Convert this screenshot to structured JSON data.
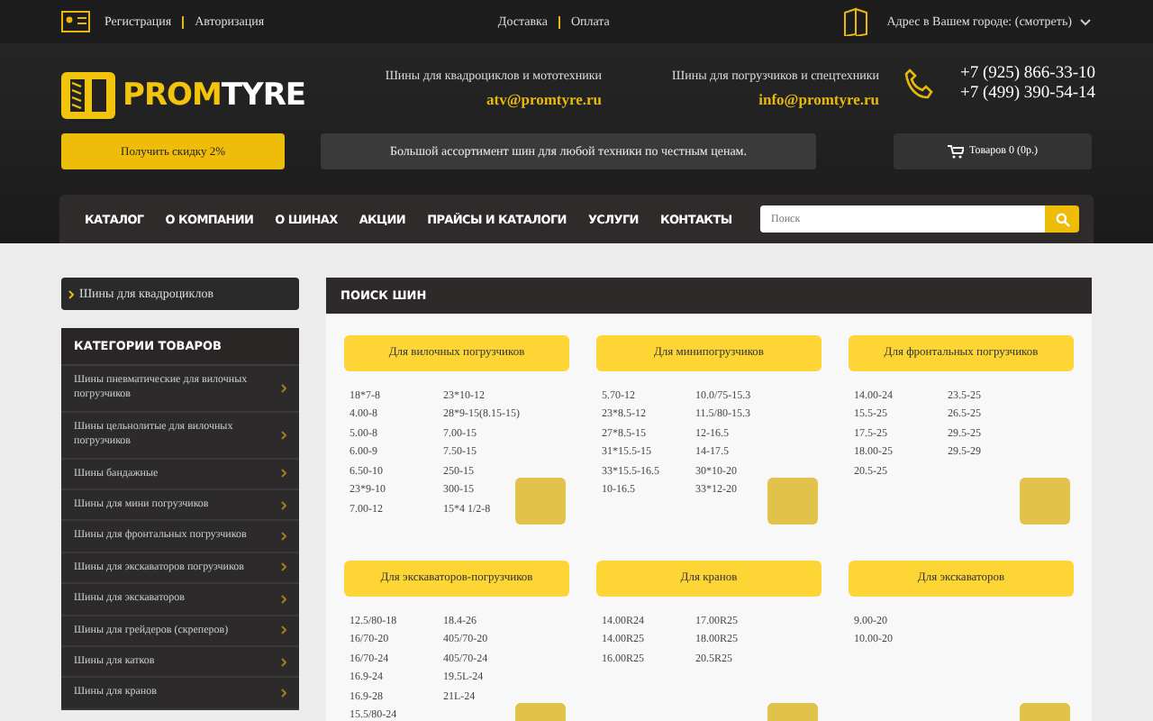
{
  "topbar": {
    "auth_links": [
      "Регистрация",
      "Авторизация"
    ],
    "info_links": [
      "Доставка",
      "Оплата"
    ],
    "address": "Адрес в Вашем городе: (смотреть)"
  },
  "header": {
    "logo": {
      "part1": "PROM",
      "part2": "TYRE"
    },
    "contacts": [
      {
        "label": "Шины для квадроциклов и мототехники",
        "email": "atv@promtyre.ru"
      },
      {
        "label": "Шины для погрузчиков и спецтехники",
        "email": "info@promtyre.ru"
      }
    ],
    "phones": [
      "+7 (925) 866-33-10",
      "+7 (499) 390-54-14"
    ],
    "discount_button": "Получить скидку 2%",
    "slogan": "Большой ассортимент шин для любой техники по честным ценам.",
    "cart": "Товаров 0 (0р.)"
  },
  "nav": {
    "items": [
      "КАТАЛОГ",
      "О КОМПАНИИ",
      "О ШИНАХ",
      "АКЦИИ",
      "ПРАЙСЫ И КАТАЛОГИ",
      "УСЛУГИ",
      "КОНТАКТЫ"
    ],
    "search": {
      "placeholder": "Поиск"
    }
  },
  "sidebar": {
    "atv_link": "Шины для квадроциклов",
    "categories_title": "КАТЕГОРИИ ТОВАРОВ",
    "categories": [
      "Шины пневматические для вилочных погрузчиков",
      "Шины цельнолитые для вилочных погрузчиков",
      "Шины бандажные",
      "Шины для мини погрузчиков",
      "Шины для фронтальных погрузчиков",
      "Шины для экскаваторов погрузчиков",
      "Шины для экскаваторов",
      "Шины для грейдеров (скреперов)",
      "Шины для катков",
      "Шины для кранов"
    ]
  },
  "search_panel": {
    "title": "ПОИСК ШИН",
    "groups": [
      {
        "title": "Для вилочных погрузчиков",
        "columns": [
          [
            "18*7-8",
            "4.00-8",
            "5.00-8",
            "6.00-9",
            "6.50-10",
            "23*9-10",
            "7.00-12"
          ],
          [
            "23*10-12",
            "28*9-15(8.15-15)",
            "7.00-15",
            "7.50-15",
            "250-15",
            "300-15",
            "15*4 1/2-8"
          ]
        ]
      },
      {
        "title": "Для минипогрузчиков",
        "columns": [
          [
            "5.70-12",
            "23*8.5-12",
            "27*8.5-15",
            "31*15.5-15",
            "33*15.5-16.5",
            "10-16.5"
          ],
          [
            "10.0/75-15.3",
            "11.5/80-15.3",
            "12-16.5",
            "14-17.5",
            "30*10-20",
            "33*12-20"
          ]
        ]
      },
      {
        "title": "Для фронтальных погрузчиков",
        "columns": [
          [
            "14.00-24",
            "15.5-25",
            "17.5-25",
            "18.00-25",
            "20.5-25"
          ],
          [
            "23.5-25",
            "26.5-25",
            "29.5-25",
            "29.5-29"
          ]
        ]
      },
      {
        "title": "Для экскаваторов-погрузчиков",
        "columns": [
          [
            "12.5/80-18",
            "16/70-20",
            "16/70-24",
            "16.9-24",
            "16.9-28",
            "15.5/80-24"
          ],
          [
            "18.4-26",
            "405/70-20",
            "405/70-24",
            "19.5L-24",
            "21L-24"
          ]
        ]
      },
      {
        "title": "Для кранов",
        "columns": [
          [
            "14.00R24",
            "14.00R25",
            "16.00R25"
          ],
          [
            "17.00R25",
            "18.00R25",
            "20.5R25"
          ]
        ]
      },
      {
        "title": "Для экскаваторов",
        "columns": [
          [
            "9.00-20",
            "10.00-20"
          ]
        ]
      }
    ]
  }
}
